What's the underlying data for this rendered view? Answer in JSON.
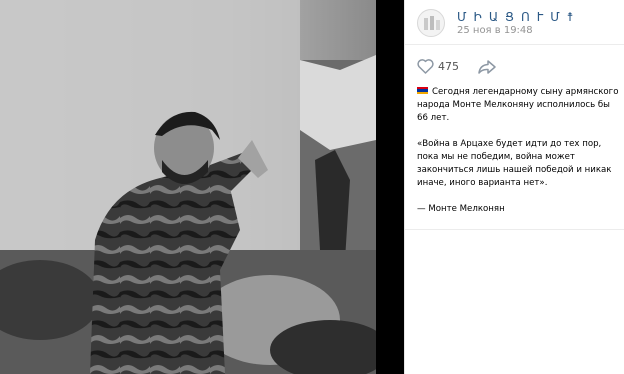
{
  "photo": {
    "description_icon": "black-and-white-photo-man-pointing"
  },
  "header": {
    "author": "Մ Ի Ա Ց Ո Ւ Մ ☨",
    "date": "25 ноя в 19:48",
    "avatar_icon": "community-avatar-icon"
  },
  "actions": {
    "like_icon": "heart-icon",
    "like_count": "475",
    "share_icon": "share-arrow-icon"
  },
  "post": {
    "flag_icon": "armenia-flag-icon",
    "flag_colors": [
      "#d90012",
      "#0033a0",
      "#f2a800"
    ],
    "paragraph1": "Сегодня легендарному сыну армянского народа Монте Мелконяну исполнилось бы 66 лет.",
    "paragraph2": "«Война в Арцахе будет идти до тех пор, пока мы не победим, война может закончиться лишь нашей победой и никак иначе, иного варианта нет».",
    "paragraph3": "— Монте Мелконян"
  },
  "colors": {
    "author_link": "#2a5885",
    "muted": "#939393"
  }
}
